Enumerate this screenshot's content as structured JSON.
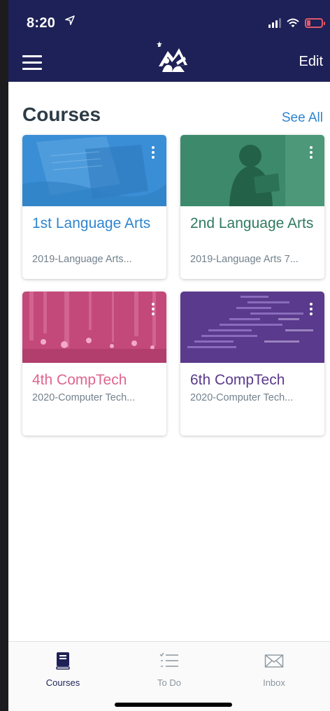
{
  "status_bar": {
    "time": "8:20",
    "location_icon": "location-arrow-icon",
    "signal_icon": "signal-icon",
    "wifi_icon": "wifi-icon",
    "battery_icon": "battery-low-charging-icon"
  },
  "header": {
    "menu_icon": "hamburger-menu-icon",
    "logo": "school-logo",
    "edit_label": "Edit",
    "background": "#1e2157"
  },
  "courses": {
    "title": "Courses",
    "see_all_label": "See All",
    "items": [
      {
        "name": "1st Language Arts",
        "code": "2019-Language Arts...",
        "color": "#2f85cf"
      },
      {
        "name": "2nd Language Arts",
        "code": "2019-Language Arts 7...",
        "color": "#2f7a5e"
      },
      {
        "name": "4th CompTech",
        "code": "2020-Computer Tech...",
        "color": "#e0648e"
      },
      {
        "name": "6th CompTech",
        "code": "2020-Computer Tech...",
        "color": "#5b3a8c"
      }
    ]
  },
  "tabbar": {
    "tabs": [
      {
        "label": "Courses",
        "icon": "book-icon",
        "active": true
      },
      {
        "label": "To Do",
        "icon": "checklist-icon",
        "active": false
      },
      {
        "label": "Inbox",
        "icon": "envelope-icon",
        "active": false
      }
    ]
  }
}
